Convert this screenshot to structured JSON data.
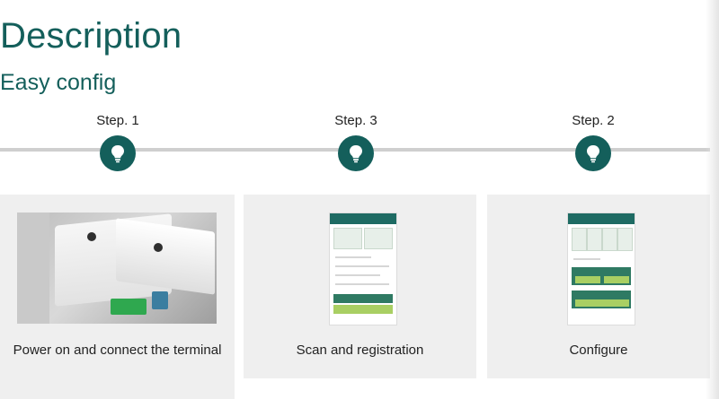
{
  "header": {
    "title": "Description",
    "subtitle": "Easy config"
  },
  "steps": [
    {
      "label": "Step. 1",
      "icon": "lightbulb-icon"
    },
    {
      "label": "Step. 3",
      "icon": "lightbulb-icon"
    },
    {
      "label": "Step. 2",
      "icon": "lightbulb-icon"
    }
  ],
  "cards": [
    {
      "caption": "Power on and connect the terminal"
    },
    {
      "caption": "Scan and registration"
    },
    {
      "caption": "Configure"
    }
  ],
  "colors": {
    "accent": "#145f5b",
    "line": "#cfcfcf",
    "card_bg": "#efefef"
  }
}
